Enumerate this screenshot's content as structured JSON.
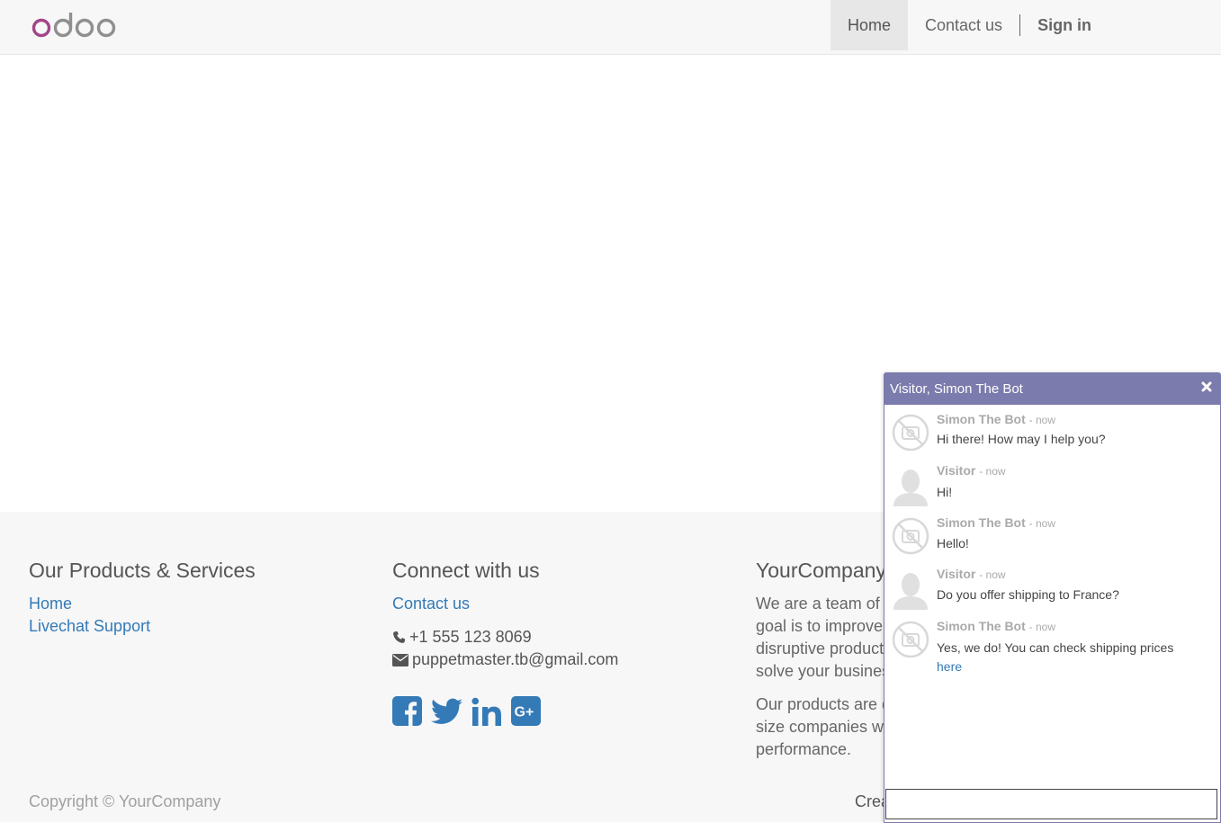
{
  "header": {
    "logo_text": "odoo",
    "nav": [
      {
        "label": "Home"
      },
      {
        "label": "Contact us"
      },
      {
        "label": "Sign in"
      }
    ]
  },
  "footer": {
    "products": {
      "title": "Our Products & Services",
      "links": [
        "Home",
        "Livechat Support"
      ]
    },
    "connect": {
      "title": "Connect with us",
      "contact_link": "Contact us",
      "phone": "+1 555 123 8069",
      "email": "puppetmaster.tb@gmail.com",
      "social_icons": [
        "facebook-icon",
        "twitter-icon",
        "linkedin-icon",
        "google-plus-icon"
      ]
    },
    "company": {
      "title": "YourCompany",
      "para1": "We are a team of p goal is to improve disruptive products solve your busines",
      "para1_lines": [
        "We are a team of p",
        "goal is to improve",
        "disruptive products",
        "solve your busines"
      ],
      "para2_lines": [
        "Our products are d",
        "size companies wi",
        "performance."
      ]
    },
    "copyright": "Copyright © YourCompany",
    "created": "Crea"
  },
  "chat": {
    "title": "Visitor, Simon The Bot",
    "messages": [
      {
        "author": "Simon The Bot",
        "time": "- now",
        "text": "Hi there! How may I help you?",
        "avatar": "bot"
      },
      {
        "author": "Visitor",
        "time": "- now",
        "text": "Hi!",
        "avatar": "visitor"
      },
      {
        "author": "Simon The Bot",
        "time": "- now",
        "text": "Hello!",
        "avatar": "bot"
      },
      {
        "author": "Visitor",
        "time": "- now",
        "text": "Do you offer shipping to France?",
        "avatar": "visitor"
      },
      {
        "author": "Simon The Bot",
        "time": "- now",
        "text": "Yes, we do! You can check shipping prices",
        "link": "here",
        "avatar": "bot"
      }
    ],
    "input_value": ""
  },
  "colors": {
    "chat_header": "#7c7bad",
    "link": "#337ab7",
    "logo_purple": "#a24689",
    "logo_gray": "#8f8f8f"
  }
}
